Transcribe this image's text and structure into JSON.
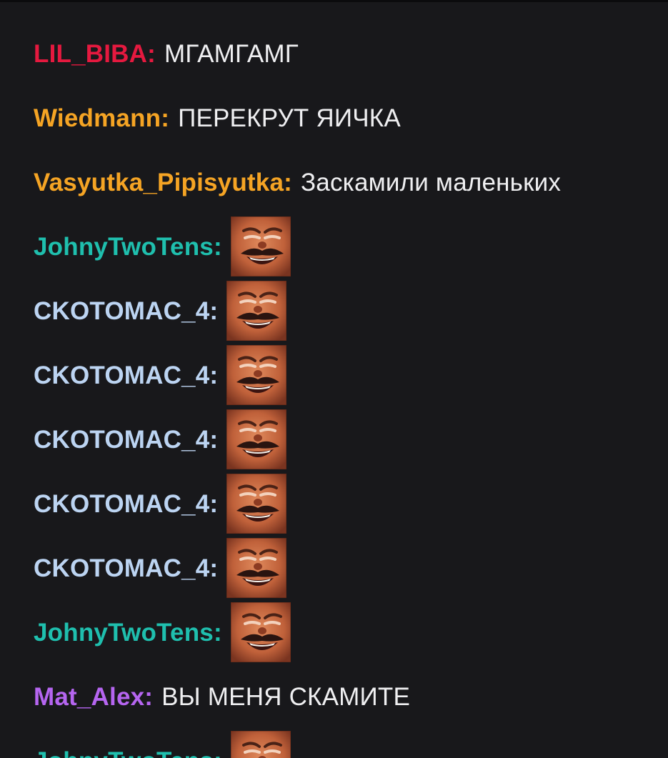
{
  "messages": [
    {
      "user": "LIL_BIBA",
      "color": "#e5193f",
      "text": "МГАМГАМГ",
      "emote": null
    },
    {
      "user": "Wiedmann",
      "color": "#f5a424",
      "text": "ПЕРЕКРУТ ЯИЧКА",
      "emote": null
    },
    {
      "user": "Vasyutka_Pipisyutka",
      "color": "#f5a424",
      "text": "Заскамили маленьких",
      "emote": null
    },
    {
      "user": "JohnyTwoTens",
      "color": "#1fbfae",
      "text": null,
      "emote": "laughing-man-emote"
    },
    {
      "user": "CKOTOMAC_4",
      "color": "#bcd4f2",
      "text": null,
      "emote": "laughing-man-emote"
    },
    {
      "user": "CKOTOMAC_4",
      "color": "#bcd4f2",
      "text": null,
      "emote": "laughing-man-emote"
    },
    {
      "user": "CKOTOMAC_4",
      "color": "#bcd4f2",
      "text": null,
      "emote": "laughing-man-emote"
    },
    {
      "user": "CKOTOMAC_4",
      "color": "#bcd4f2",
      "text": null,
      "emote": "laughing-man-emote"
    },
    {
      "user": "CKOTOMAC_4",
      "color": "#bcd4f2",
      "text": null,
      "emote": "laughing-man-emote"
    },
    {
      "user": "JohnyTwoTens",
      "color": "#1fbfae",
      "text": null,
      "emote": "laughing-man-emote"
    },
    {
      "user": "Mat_Alex",
      "color": "#b565f0",
      "text": "ВЫ МЕНЯ СКАМИТЕ",
      "emote": null
    },
    {
      "user": "JohnyTwoTens",
      "color": "#1fbfae",
      "text": null,
      "emote": "laughing-man-emote"
    }
  ],
  "colon": ":",
  "colors": {
    "background": "#18181b",
    "text": "#efeff1"
  }
}
